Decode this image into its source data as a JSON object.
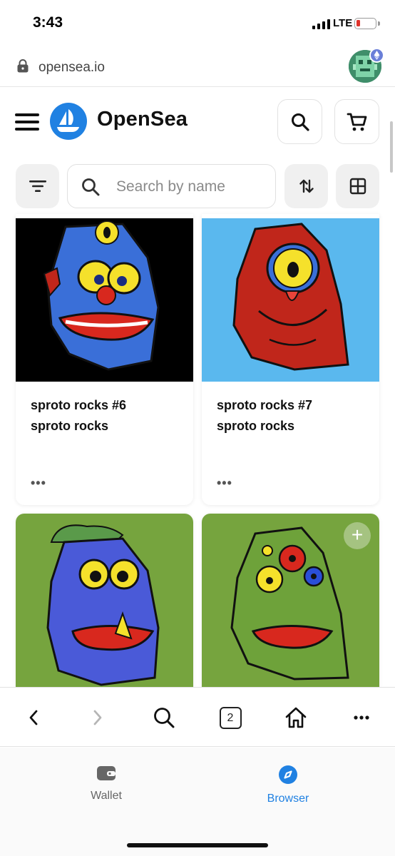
{
  "status_bar": {
    "time": "3:43",
    "network": "LTE"
  },
  "url_bar": {
    "url": "opensea.io"
  },
  "header": {
    "brand": "OpenSea"
  },
  "filter_bar": {
    "search_placeholder": "Search by name"
  },
  "cards": [
    {
      "title": "sproto rocks #6",
      "collection": "sproto rocks",
      "more": "•••",
      "bg": "#000000",
      "rock": "#3a6fd8"
    },
    {
      "title": "sproto rocks #7",
      "collection": "sproto rocks",
      "more": "•••",
      "bg": "#5ab8ee",
      "rock": "#c0261b"
    },
    {
      "bg": "#76a43e",
      "rock": "#4a5ad8"
    },
    {
      "bg": "#76a43e",
      "rock": "#6ea23a",
      "add_label": "+"
    }
  ],
  "browser_toolbar": {
    "tab_count": "2"
  },
  "bottom_tabs": [
    {
      "label": "Wallet",
      "icon": "wallet-icon",
      "active": false
    },
    {
      "label": "Browser",
      "icon": "compass-icon",
      "active": true
    }
  ],
  "colors": {
    "accent": "#2081e2",
    "browser_active": "#2081e2",
    "inactive": "#666666"
  }
}
